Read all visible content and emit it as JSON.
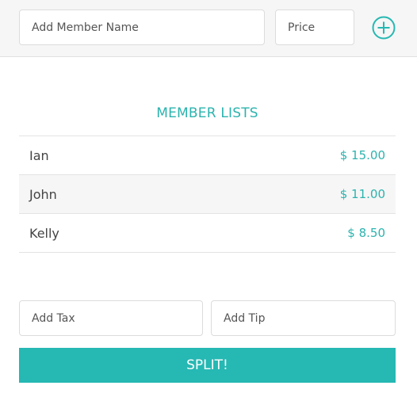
{
  "add_member": {
    "name_placeholder": "Add Member Name",
    "price_placeholder": "Price",
    "add_icon": "plus-circle-icon"
  },
  "member_list": {
    "title": "MEMBER LISTS",
    "members": [
      {
        "name": "Ian",
        "price": "$ 15.00"
      },
      {
        "name": "John",
        "price": "$ 11.00"
      },
      {
        "name": "Kelly",
        "price": "$ 8.50"
      }
    ]
  },
  "extras": {
    "tax_placeholder": "Add Tax",
    "tip_placeholder": "Add Tip"
  },
  "split_label": "SPLIT!",
  "colors": {
    "accent": "#26b8b3",
    "text": "#444444",
    "stripe": "#f6f6f6"
  }
}
